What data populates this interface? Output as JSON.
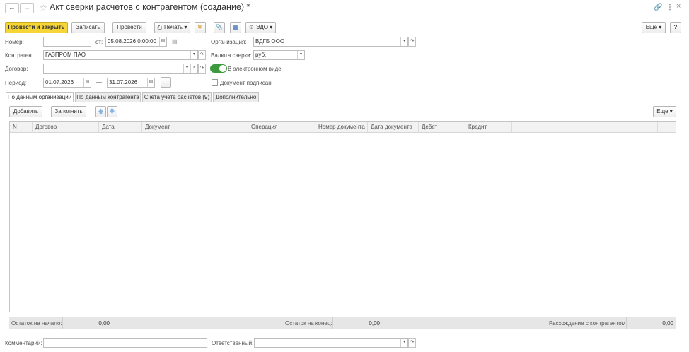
{
  "window": {
    "title": "Акт сверки расчетов с контрагентом (создание) *"
  },
  "toolbar": {
    "post_close": "Провести и закрыть",
    "save": "Записать",
    "post": "Провести",
    "print": "Печать",
    "edo": "ЭДО",
    "more": "Еще",
    "help": "?"
  },
  "form": {
    "number_label": "Номер:",
    "number_value": "",
    "from_label": "от:",
    "date_value": "05.08.2026  0:00:00",
    "org_label": "Организация:",
    "org_value": "ВДГБ ООО",
    "counterparty_label": "Контрагент:",
    "counterparty_value": "ГАЗПРОМ ПАО",
    "currency_label": "Валюта сверки:",
    "currency_value": "руб.",
    "contract_label": "Договор:",
    "contract_value": "",
    "electronic_label": "В электронном виде",
    "electronic_on": true,
    "period_label": "Период:",
    "period_from": "01.07.2026",
    "period_dash": "—",
    "period_to": "31.07.2026",
    "period_more": "...",
    "signed_label": "Документ подписан",
    "signed_checked": false
  },
  "tabs": [
    {
      "label": "По данным организации",
      "active": true
    },
    {
      "label": "По данным контрагента",
      "active": false
    },
    {
      "label": "Счета учета расчетов (9)",
      "active": false
    },
    {
      "label": "Дополнительно",
      "active": false
    }
  ],
  "tab_toolbar": {
    "add": "Добавить",
    "fill": "Заполнить",
    "more": "Еще"
  },
  "table": {
    "columns": [
      "N",
      "Договор",
      "Дата",
      "Документ",
      "Операция",
      "Номер документа",
      "Дата документа",
      "Дебет",
      "Кредит"
    ],
    "rows": []
  },
  "totals": {
    "start_label": "Остаток на начало:",
    "start_value": "0,00",
    "end_label": "Остаток на конец:",
    "end_value": "0,00",
    "diff_label": "Расхождение с контрагентом:",
    "diff_value": "0,00"
  },
  "footer": {
    "comment_label": "Комментарий:",
    "comment_value": "",
    "responsible_label": "Ответственный:",
    "responsible_value": ""
  },
  "icons": {
    "back": "arrow-left-icon",
    "forward": "arrow-right-icon",
    "favorite": "star-icon",
    "link": "link-icon",
    "menu": "kebab-menu-icon",
    "close": "close-icon",
    "printer": "printer-icon",
    "mail": "envelope-icon",
    "attach": "paperclip-icon",
    "structure": "structure-icon",
    "calendar": "calendar-icon",
    "up": "arrow-up-icon",
    "down": "arrow-down-icon"
  },
  "colors": {
    "primary_button": "#f6d636",
    "toggle_on": "#3c9a3c",
    "totals_bar": "#e6e6e6"
  }
}
